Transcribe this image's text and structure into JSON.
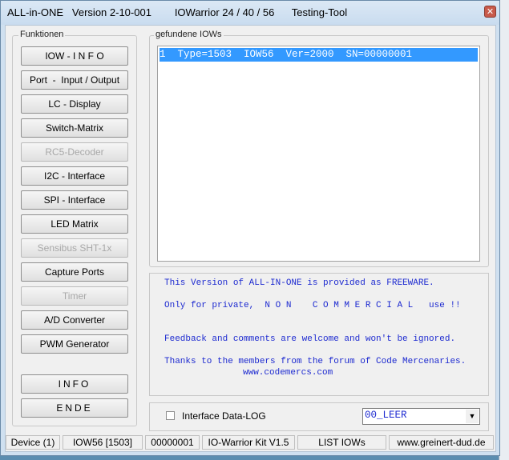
{
  "window": {
    "title": "ALL-in-ONE   Version 2-10-001        IOWarrior 24 / 40 / 56      Testing-Tool",
    "close_glyph": "✕"
  },
  "funktionen": {
    "label": "Funktionen",
    "buttons": [
      {
        "label": "IOW - I N F O",
        "enabled": true
      },
      {
        "label": "Port  -  Input / Output",
        "enabled": true
      },
      {
        "label": "LC - Display",
        "enabled": true
      },
      {
        "label": "Switch-Matrix",
        "enabled": true
      },
      {
        "label": "RC5-Decoder",
        "enabled": false
      },
      {
        "label": "I2C - Interface",
        "enabled": true
      },
      {
        "label": "SPI - Interface",
        "enabled": true
      },
      {
        "label": "LED Matrix",
        "enabled": true
      },
      {
        "label": "Sensibus SHT-1x",
        "enabled": false
      },
      {
        "label": "Capture Ports",
        "enabled": true
      },
      {
        "label": "Timer",
        "enabled": false
      },
      {
        "label": "A/D Converter",
        "enabled": true
      },
      {
        "label": "PWM Generator",
        "enabled": true
      }
    ],
    "info_button": "INFO",
    "ende_button": "ENDE"
  },
  "iows": {
    "label": "gefundene IOWs",
    "items": [
      "1  Type=1503  IOW56  Ver=2000  SN=00000001"
    ]
  },
  "info": {
    "lines": [
      "This Version of ALL-IN-ONE is provided as FREEWARE.",
      "Only for private,  N O N    C O M M E R C I A L   use !!",
      "Feedback and comments are welcome and won't be ignored.",
      "Thanks to the members from the forum of Code Mercenaries.",
      "www.codemercs.com"
    ]
  },
  "log": {
    "checkbox_label": "Interface Data-LOG",
    "checked": false,
    "combo_value": "00_LEER",
    "combo_arrow": "▼"
  },
  "status": [
    "Device (1)",
    "IOW56 [1503]",
    "00000001",
    "IO-Warrior Kit V1.5",
    "LIST IOWs",
    "www.greinert-dud.de"
  ],
  "colors": {
    "accent_text": "#1d2ad0",
    "selection": "#3399ff"
  }
}
